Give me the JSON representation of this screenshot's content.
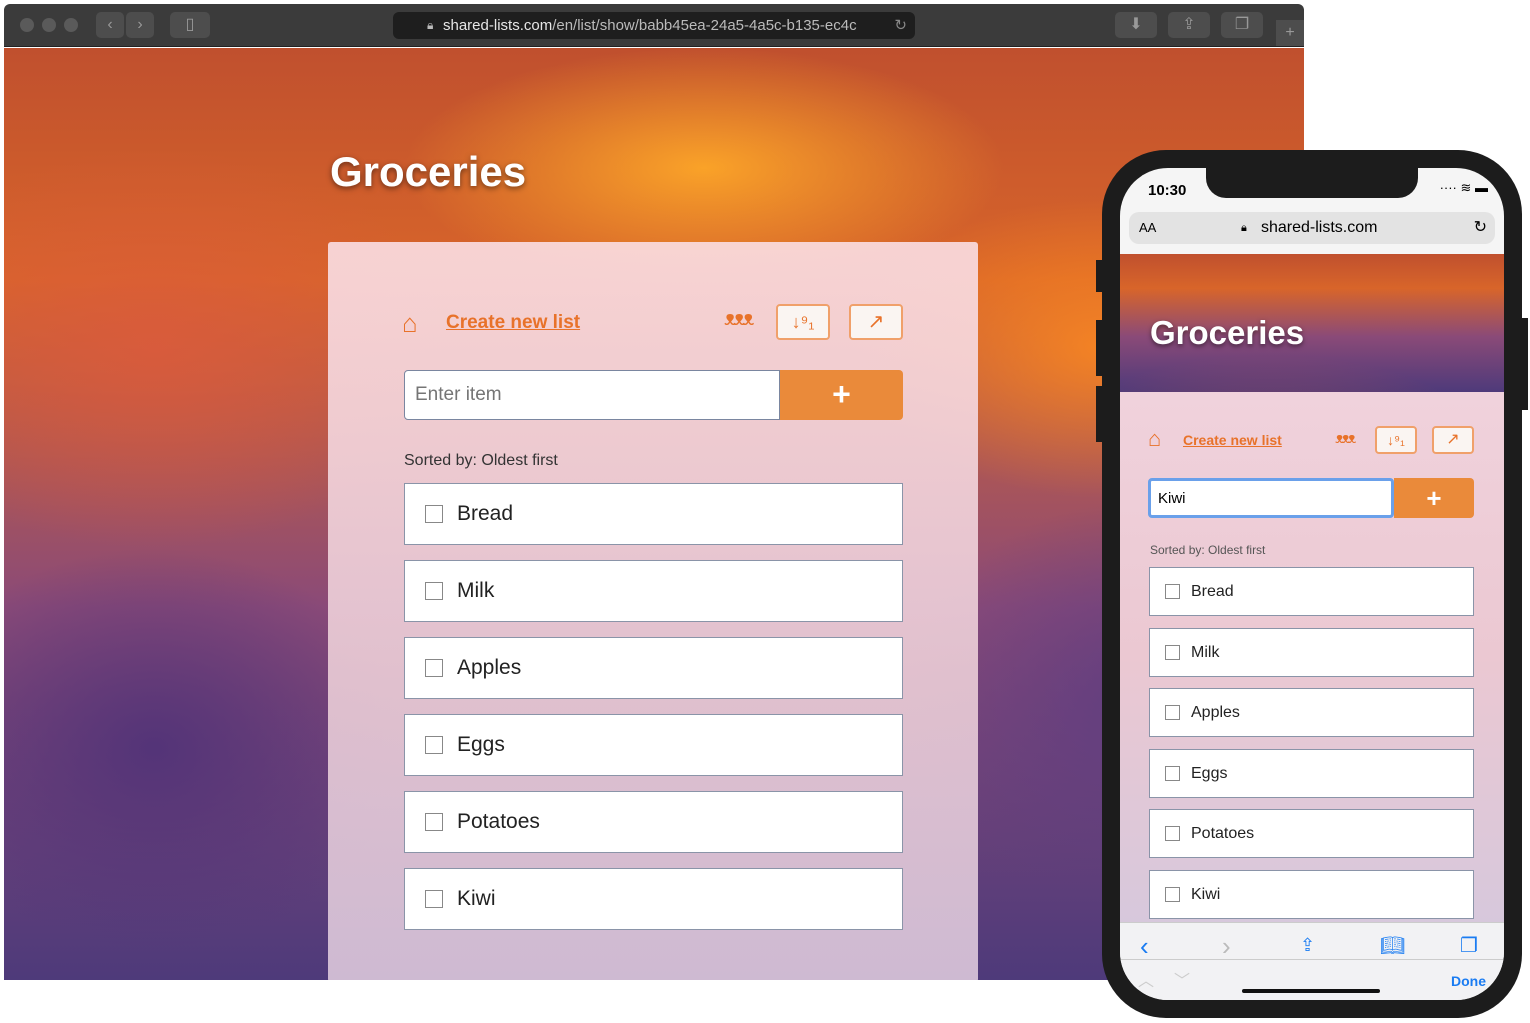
{
  "browser": {
    "url_host": "shared-lists.com",
    "url_path": "/en/list/show/babb45ea-24a5-4a5c-b135-ec4c"
  },
  "list": {
    "title": "Groceries",
    "create_link": "Create new list",
    "input_placeholder": "Enter item",
    "add_label": "+",
    "sorted_label": "Sorted by:",
    "sorted_value": "Oldest first",
    "items": [
      "Bread",
      "Milk",
      "Apples",
      "Eggs",
      "Potatoes",
      "Kiwi"
    ]
  },
  "phone": {
    "time": "10:30",
    "aa": "AA",
    "url": "shared-lists.com",
    "input_value": "Kiwi",
    "done": "Done"
  },
  "colors": {
    "accent": "#e8722a",
    "ios_blue": "#1a7cf2"
  }
}
